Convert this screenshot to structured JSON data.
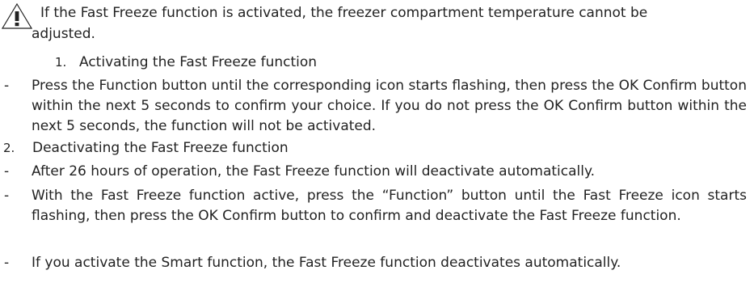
{
  "warning": {
    "icon": "warning-triangle-icon",
    "line1": "If the Fast Freeze function is activated, the freezer compartment temperature cannot be",
    "line2": "adjusted."
  },
  "section1": {
    "number": "1.",
    "title": "Activating the Fast Freeze function",
    "bullets": [
      {
        "marker": "-",
        "text": "Press the Function button until the corresponding icon starts flashing, then press the OK Confirm button within the next 5 seconds to confirm your choice. If you do not press the OK Confirm button within the next 5 seconds, the function will not be activated."
      }
    ]
  },
  "section2": {
    "number": "2.",
    "title": "Deactivating the Fast Freeze function",
    "bullets": [
      {
        "marker": "-",
        "text": "After 26 hours of operation, the Fast Freeze function will deactivate automatically."
      },
      {
        "marker": "-",
        "text": "With the Fast Freeze function active, press the “Function” button until the Fast Freeze icon starts flashing, then press the OK Confirm button to confirm and deactivate the Fast Freeze function."
      },
      {
        "marker": "-",
        "text": "If you activate the Smart function, the Fast Freeze function deactivates automatically."
      }
    ]
  }
}
